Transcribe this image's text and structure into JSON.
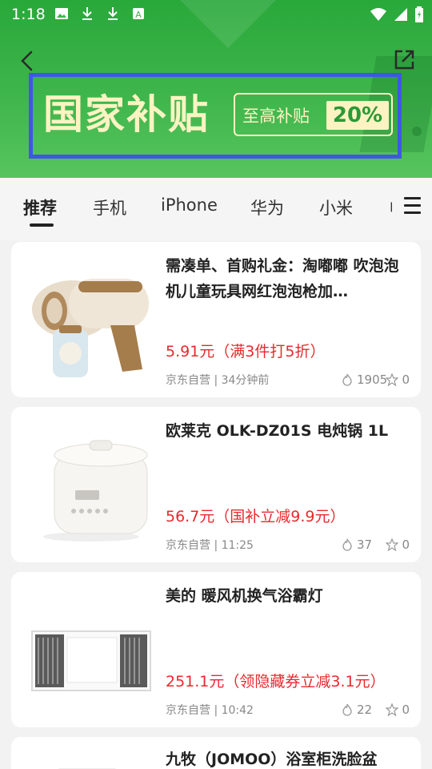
{
  "status_bar": {
    "time": "1:18",
    "left_icons": [
      "image-icon",
      "download-icon",
      "download-icon",
      "a-icon"
    ],
    "right_icons": [
      "wifi-icon",
      "signal-icon",
      "battery-icon"
    ]
  },
  "header": {
    "back_icon": "back-arrow-icon",
    "share_icon": "share-external-icon",
    "banner": {
      "title": "国家补贴",
      "subtitle": "至高补贴",
      "percent": "20%"
    }
  },
  "tabs": {
    "items": [
      "推荐",
      "手机",
      "iPhone",
      "华为",
      "小米",
      "电"
    ],
    "active_index": 0,
    "menu_icon": "menu-icon"
  },
  "products": [
    {
      "title": "需凑单、首购礼金：淘嘟嘟 吹泡泡机儿童玩具网红泡泡枪加…",
      "price": "5.91元（满3件打5折）",
      "meta": "京东自营 | 34分钟前",
      "hot": "1905",
      "fav": "0"
    },
    {
      "title": "欧莱克 OLK-DZ01S 电炖锅 1L",
      "price": "56.7元（国补立减9.9元）",
      "meta": "京东自营 | 11:25",
      "hot": "37",
      "fav": "0"
    },
    {
      "title": "美的 暖风机换气浴霸灯",
      "price": "251.1元（领隐藏券立减3.1元）",
      "meta": "京东自营 | 10:42",
      "hot": "22",
      "fav": "0"
    },
    {
      "title": "九牧（JOMOO）浴室柜洗脸盆"
    }
  ],
  "colors": {
    "header_green": "#3fb64c",
    "banner_text": "#fdf3c2",
    "banner_border": "#3f57e6",
    "price_red": "#e8292e"
  }
}
